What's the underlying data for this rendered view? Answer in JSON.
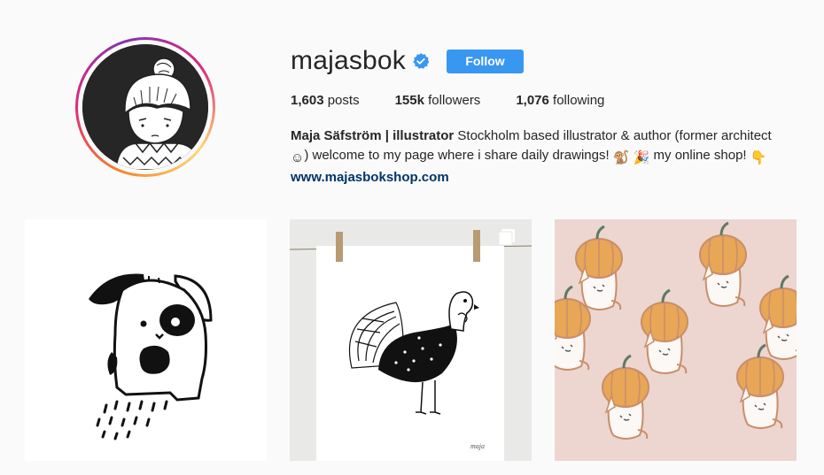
{
  "profile": {
    "username": "majasbok",
    "follow_label": "Follow",
    "verified": true,
    "accent_color": "#3897f0"
  },
  "stats": {
    "posts_count": "1,603",
    "posts_label": "posts",
    "followers_count": "155k",
    "followers_label": "followers",
    "following_count": "1,076",
    "following_label": "following"
  },
  "bio": {
    "name": "Maja Säfström | illustrator",
    "text1": " Stockholm based illustrator & author (former architect ",
    "emoji1": "☺",
    "text2": ") welcome to my page where i share daily drawings! ",
    "emoji2": "🐒",
    "emoji3": "🎉",
    "text3": " my online shop! ",
    "emoji4": "👇",
    "link": "www.majasbokshop.com"
  },
  "posts": [
    {
      "subject": "bunny-illustration",
      "multi": false
    },
    {
      "subject": "turkey-illustration-print",
      "multi": true,
      "signature": "maja"
    },
    {
      "subject": "pumpkin-cat-pins",
      "multi": false
    }
  ]
}
